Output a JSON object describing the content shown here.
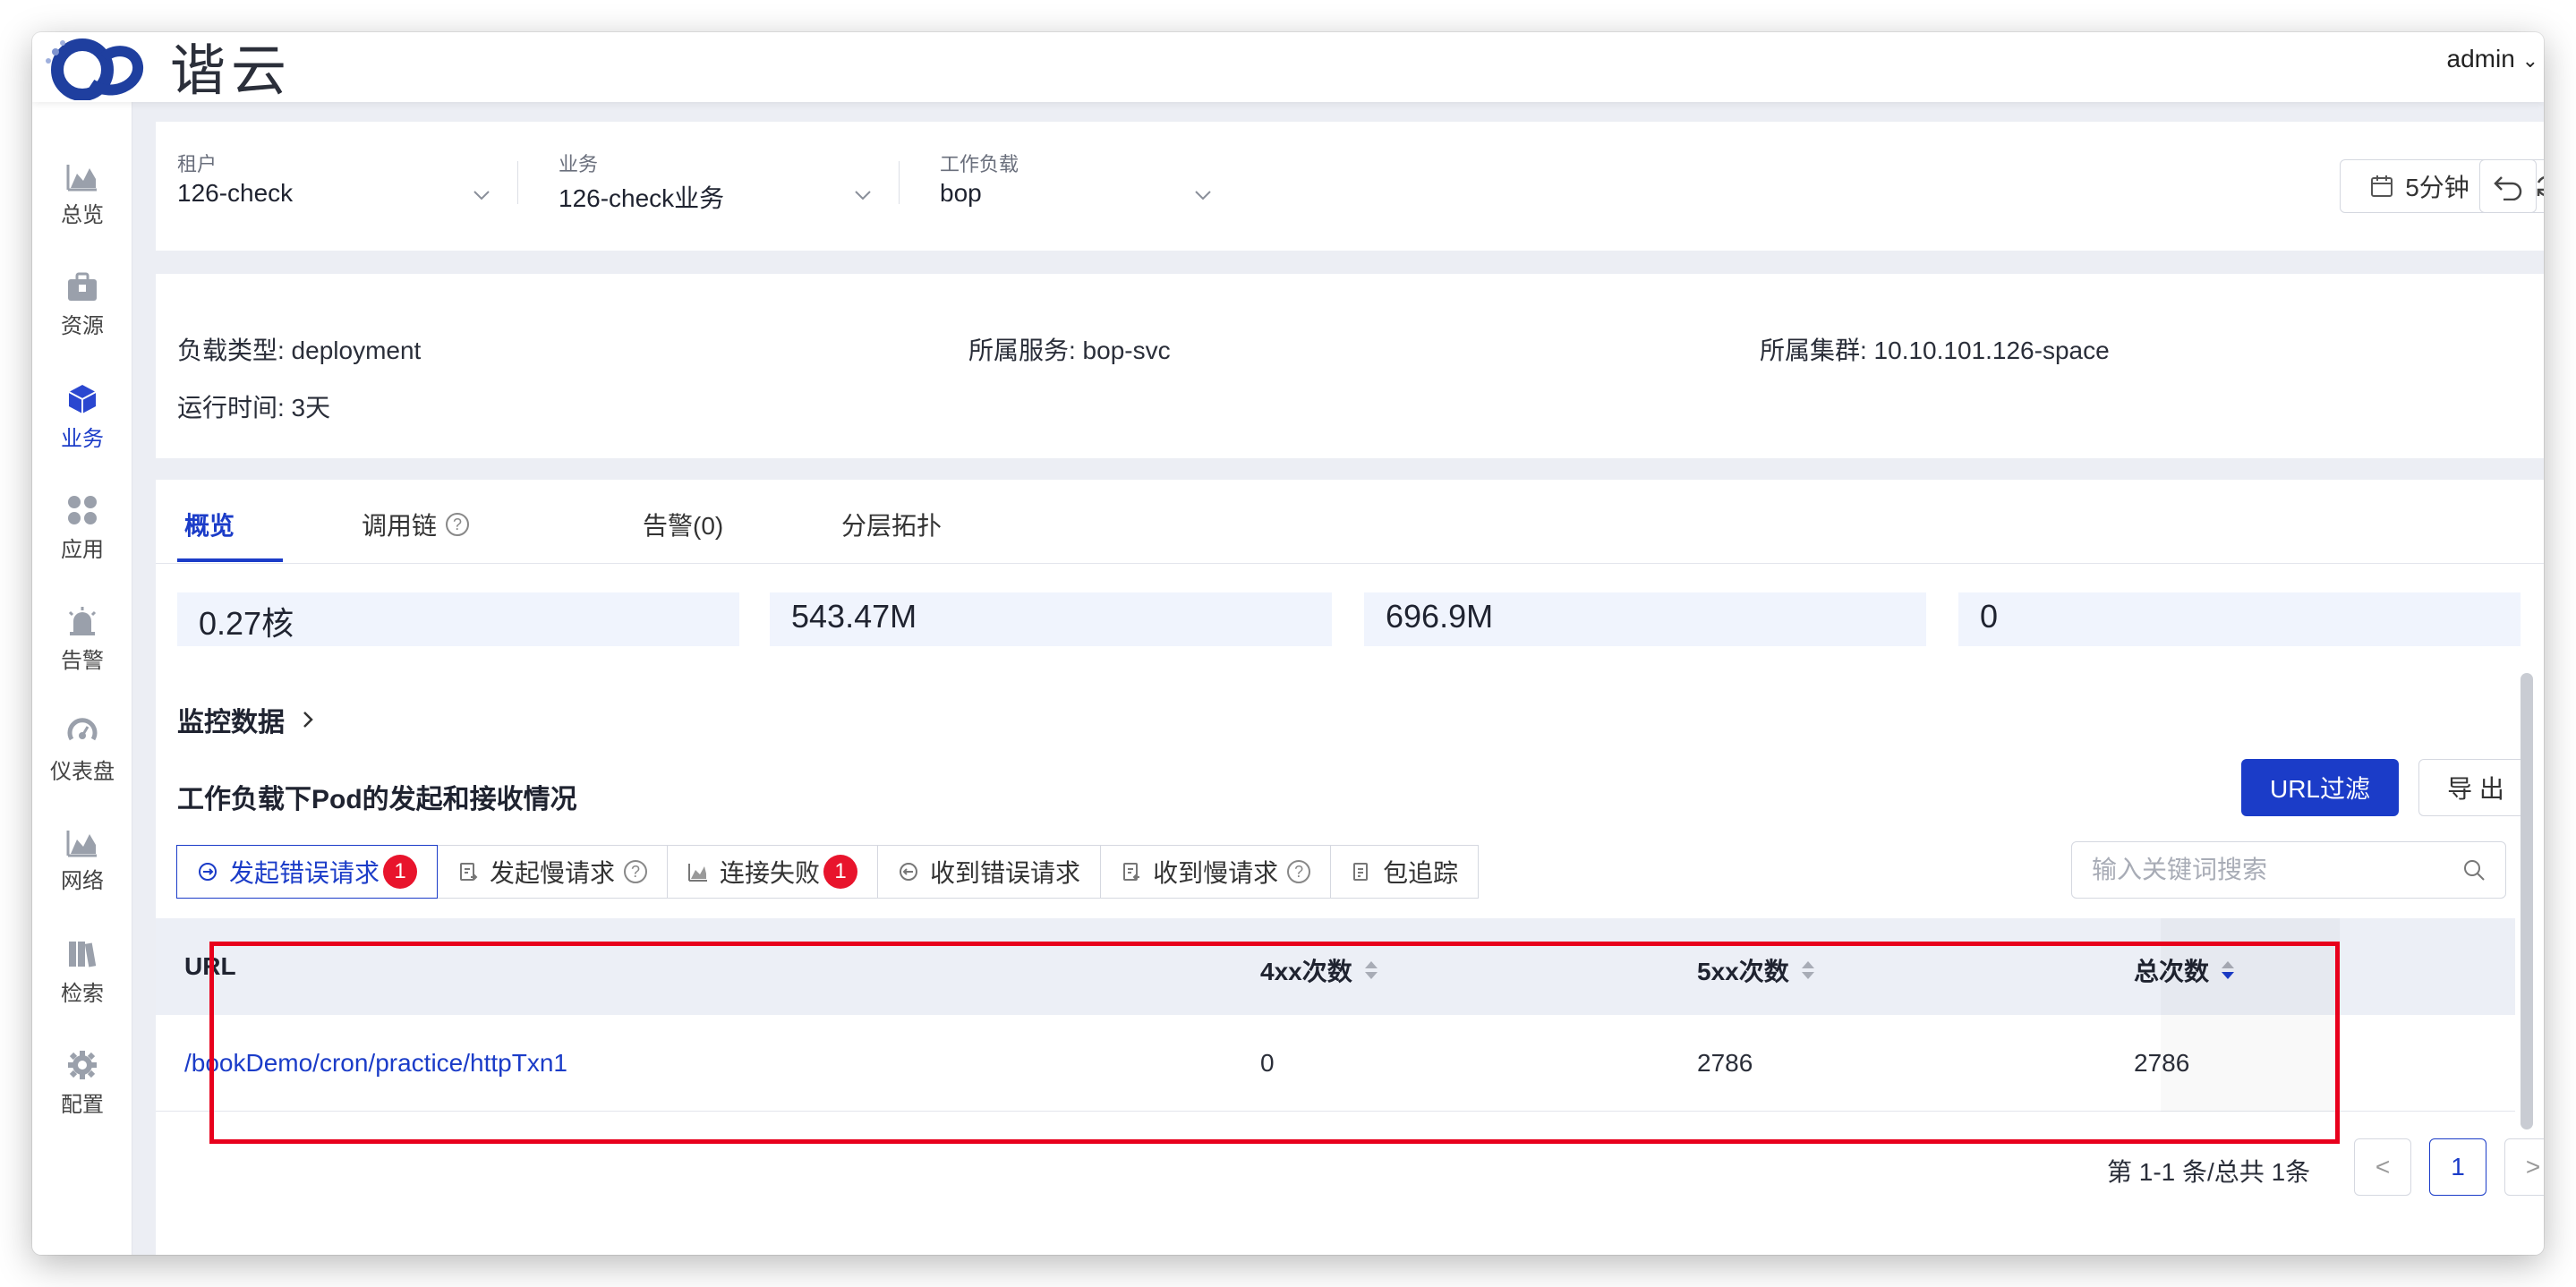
{
  "app": {
    "logo_text": "谐云",
    "user": "admin"
  },
  "sidebar": {
    "items": [
      {
        "label": "总览",
        "icon": "area-chart-icon"
      },
      {
        "label": "资源",
        "icon": "briefcase-icon"
      },
      {
        "label": "业务",
        "icon": "cube-icon"
      },
      {
        "label": "应用",
        "icon": "apps-grid-icon"
      },
      {
        "label": "告警",
        "icon": "siren-icon"
      },
      {
        "label": "仪表盘",
        "icon": "gauge-icon"
      },
      {
        "label": "网络",
        "icon": "area-chart-icon"
      },
      {
        "label": "检索",
        "icon": "books-icon"
      },
      {
        "label": "配置",
        "icon": "gear-icon"
      }
    ],
    "active": "业务"
  },
  "filters": {
    "tenant": {
      "label": "租户",
      "value": "126-check"
    },
    "business": {
      "label": "业务",
      "value": "126-check业务"
    },
    "workload": {
      "label": "工作负载",
      "value": "bop"
    },
    "time_range": "5分钟"
  },
  "info": {
    "workload_type": "负载类型: deployment",
    "service": "所属服务: bop-svc",
    "cluster": "所属集群: 10.10.101.126-space",
    "uptime": "运行时间: 3天"
  },
  "tabs": [
    {
      "label": "概览",
      "active": true
    },
    {
      "label": "调用链",
      "help": "?"
    },
    {
      "label": "告警(0)"
    },
    {
      "label": "分层拓扑"
    }
  ],
  "metrics": [
    "0.27核",
    "543.47M",
    "696.9M",
    "0"
  ],
  "monitor_title": "监控数据",
  "section_title": "工作负载下Pod的发起和接收情况",
  "buttons": {
    "url_filter": "URL过滤",
    "export": "导 出"
  },
  "segments": [
    {
      "label": "发起错误请求",
      "icon": "error-request-icon",
      "badge": "1",
      "active": true
    },
    {
      "label": "发起慢请求",
      "icon": "slow-request-icon",
      "help": "?"
    },
    {
      "label": "连接失败",
      "icon": "bar-chart-icon",
      "badge": "1"
    },
    {
      "label": "收到错误请求",
      "icon": "error-request-icon"
    },
    {
      "label": "收到慢请求",
      "icon": "slow-request-icon",
      "help": "?"
    },
    {
      "label": "包追踪",
      "icon": "packet-trace-icon"
    }
  ],
  "search": {
    "placeholder": "输入关键词搜索"
  },
  "table": {
    "columns": [
      "URL",
      "4xx次数",
      "5xx次数",
      "总次数"
    ],
    "rows": [
      {
        "url": "/bookDemo/cron/practice/httpTxn1",
        "c4xx": "0",
        "c5xx": "2786",
        "total": "2786"
      }
    ]
  },
  "pagination": {
    "summary": "第 1-1 条/总共 1条",
    "current": "1",
    "prev": "<",
    "next": ">"
  },
  "colors": {
    "primary": "#1b3cc8",
    "badge": "#e8142c",
    "highlight": "#e8001c"
  }
}
